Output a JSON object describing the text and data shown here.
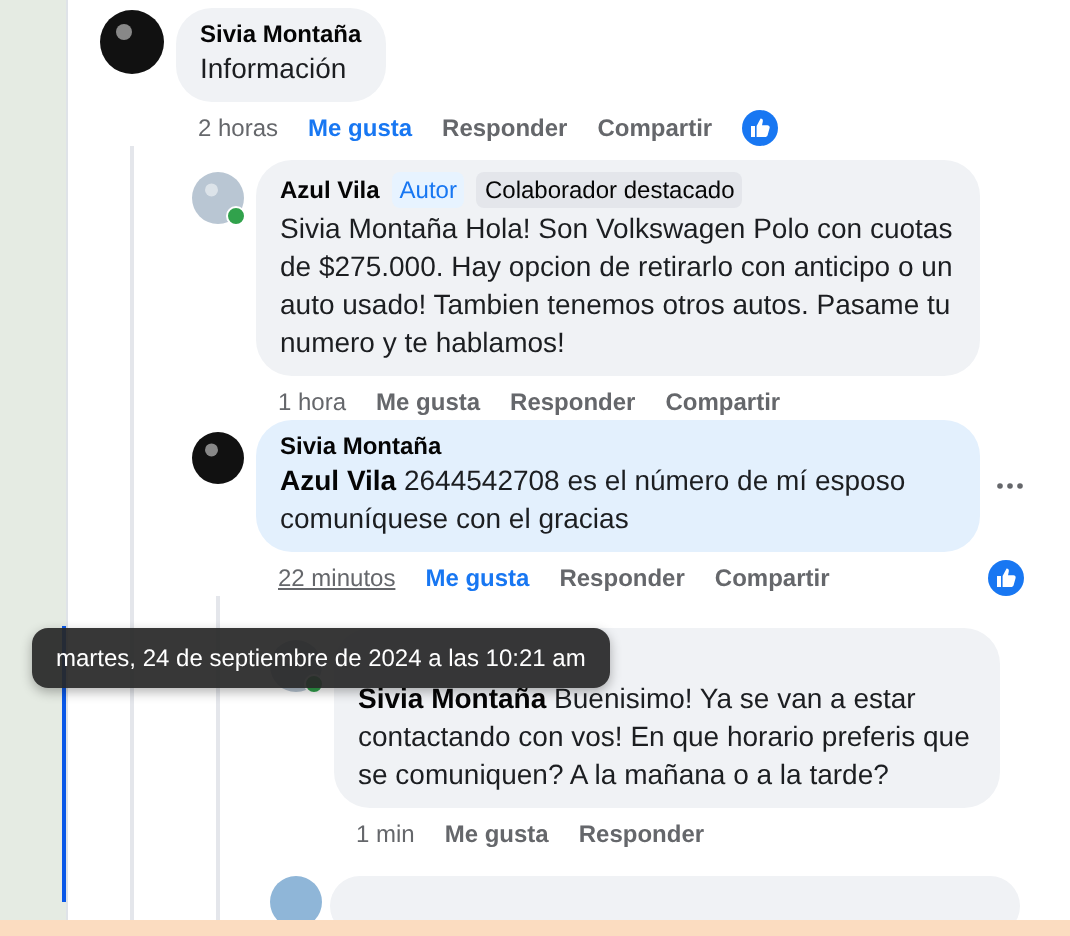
{
  "comments": [
    {
      "author": "Sivia Montaña",
      "avatar": {
        "color": "#111111"
      },
      "body": "Información",
      "bubble": {
        "color": "#f0f2f5"
      },
      "time": "2 horas",
      "like": "Me gusta",
      "liked": true,
      "reply": "Responder",
      "share": "Compartir",
      "reaction": true,
      "children": [
        {
          "author": "Azul Vila",
          "avatar": {
            "color": "#b9c6d3"
          },
          "online": true,
          "badges": [
            {
              "label": "Autor",
              "kind": "role"
            },
            {
              "label": "Colaborador destacado",
              "kind": "tag"
            }
          ],
          "body": "Sivia Montaña Hola! Son Volkswagen Polo con cuotas de $275.000. Hay opcion de retirarlo con anticipo o un auto usado! Tambien tenemos otros autos. Pasame tu numero y te hablamos!",
          "bubble": {
            "color": "#f0f2f5"
          },
          "time": "1 hora",
          "like": "Me gusta",
          "liked": false,
          "reply": "Responder",
          "share": "Compartir"
        },
        {
          "author": "Sivia Montaña",
          "avatar": {
            "color": "#111111"
          },
          "body": "**Azul Vila** 2644542708 es el número de mí esposo comuníquese con el gracias",
          "bubble": {
            "color": "#e3f0fd"
          },
          "menu": true,
          "time": "22 minutos",
          "time_hovered": true,
          "like": "Me gusta",
          "liked": true,
          "reply": "Responder",
          "share": "Compartir",
          "reaction": true,
          "children": [
            {
              "avatar": {
                "color": "#b9c6d3"
              },
              "online": true,
              "body": "**Sivia Montaña** Buenisimo! Ya se van a estar contactando con vos! En que horario preferis que se comuniquen? A la mañana o a la tarde?",
              "bubble": {
                "color": "#f0f2f5"
              },
              "time": "1 min",
              "like": "Me gusta",
              "liked": false,
              "reply": "Responder"
            }
          ]
        }
      ]
    }
  ],
  "tooltip": "martes, 24 de septiembre de 2024 a las 10:21 am"
}
